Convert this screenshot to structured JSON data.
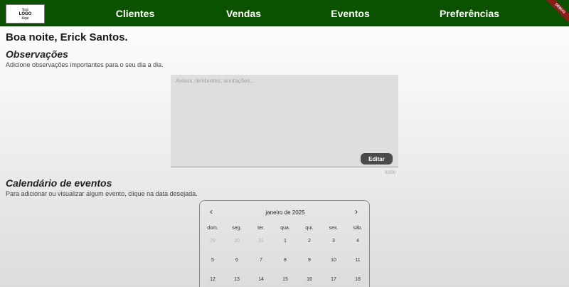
{
  "header": {
    "logo": {
      "line1": "Sua",
      "line2": "LOGO",
      "line3": "Aqui"
    },
    "nav": [
      "Clientes",
      "Vendas",
      "Eventos",
      "Preferências"
    ],
    "debug_banner": "DEBUG",
    "colors": {
      "bar": "#0b5200",
      "text": "#ffffff"
    }
  },
  "greeting": "Boa noite, Erick Santos.",
  "notes": {
    "title": "Observações",
    "subtitle": "Adicione observações importantes para o seu dia a dia.",
    "placeholder": "Avisos, lembretes, anotações...",
    "edit_label": "Editar",
    "counter": "0/200"
  },
  "calendar": {
    "title": "Calendário de eventos",
    "subtitle": "Para adicionar ou visualizar algum evento, clique na data desejada.",
    "month_label": "janeiro de 2025",
    "prev_icon": "‹",
    "next_icon": "›",
    "weekdays": [
      "dom.",
      "seg.",
      "ter.",
      "qua.",
      "qui.",
      "sex.",
      "sáb."
    ],
    "weeks": [
      [
        "29",
        "30",
        "31",
        "1",
        "2",
        "3",
        "4"
      ],
      [
        "5",
        "6",
        "7",
        "8",
        "9",
        "10",
        "11"
      ],
      [
        "12",
        "13",
        "14",
        "15",
        "16",
        "17",
        "18"
      ]
    ],
    "muted": [
      [
        0,
        0
      ],
      [
        0,
        1
      ],
      [
        0,
        2
      ]
    ]
  }
}
